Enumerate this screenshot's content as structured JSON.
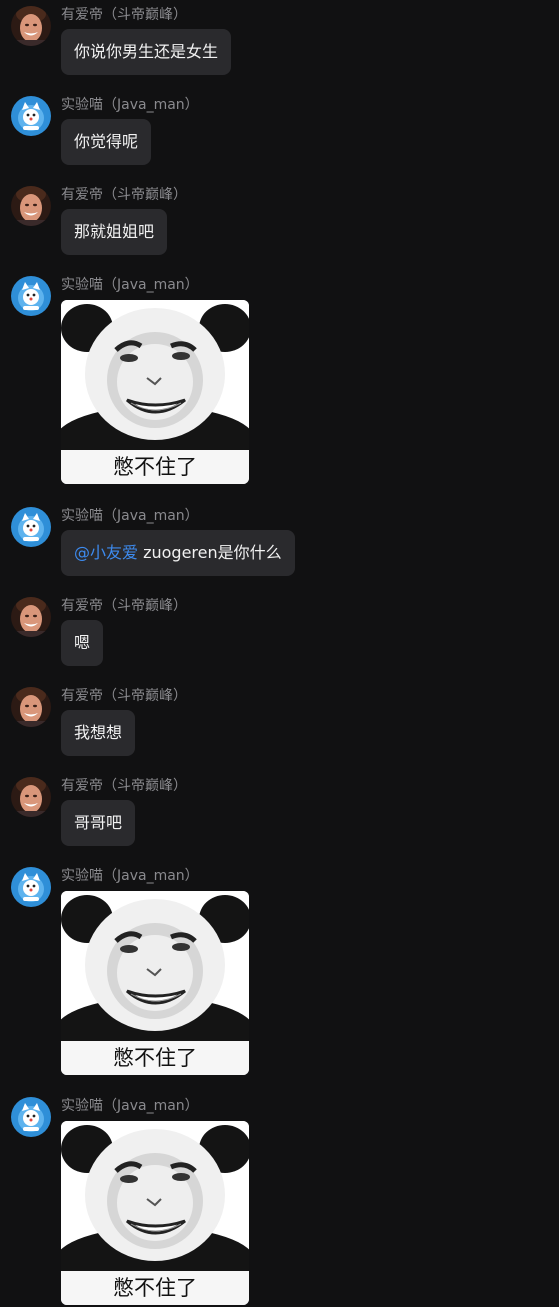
{
  "users": {
    "youai": {
      "name": "有爱帝（斗帝巅峰）",
      "avatar_icon": "smiling-man-avatar-icon"
    },
    "shiyan": {
      "name": "实验喵（Java_man）",
      "avatar_icon": "cat-robot-avatar-icon"
    }
  },
  "messages": [
    {
      "sender": "有爱帝（斗帝巅峰）",
      "text": "你说你男生还是女生"
    },
    {
      "sender": "实验喵（Java_man）",
      "text": "你觉得呢"
    },
    {
      "sender": "有爱帝（斗帝巅峰）",
      "text": "那就姐姐吧"
    },
    {
      "sender": "实验喵（Java_man）",
      "sticker_caption": "憋不住了"
    },
    {
      "sender": "实验喵（Java_man）",
      "mention": "@小友爱",
      "text": " zuogeren是你什么"
    },
    {
      "sender": "有爱帝（斗帝巅峰）",
      "text": "嗯"
    },
    {
      "sender": "有爱帝（斗帝巅峰）",
      "text": "我想想"
    },
    {
      "sender": "有爱帝（斗帝巅峰）",
      "text": "哥哥吧"
    },
    {
      "sender": "实验喵（Java_man）",
      "sticker_caption": "憋不住了"
    },
    {
      "sender": "实验喵（Java_man）",
      "sticker_caption": "憋不住了"
    }
  ],
  "colors": {
    "background": "#111112",
    "bubble": "#2a2a2d",
    "sender_name": "#8a8a8e",
    "mention": "#3d8bef"
  }
}
